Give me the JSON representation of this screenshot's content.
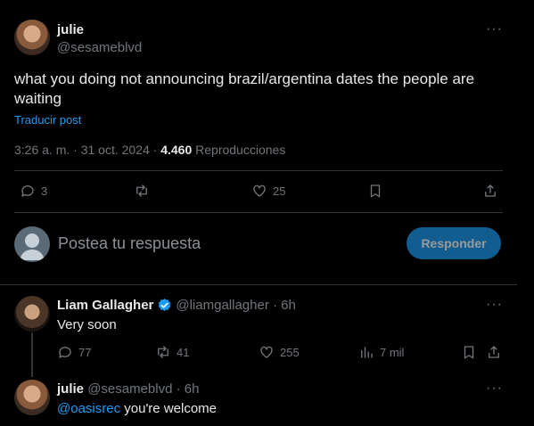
{
  "main_post": {
    "author": "julie",
    "handle": "@sesameblvd",
    "text": "what you doing not announcing brazil/argentina dates the people are waiting",
    "translate": "Traducir post",
    "time": "3:26 a. m. · 31 oct. 2024 ·",
    "views": "4.460",
    "views_label": "Reproducciones",
    "replies": "3",
    "likes": "25",
    "more": "···"
  },
  "composer": {
    "placeholder": "Postea tu respuesta",
    "button": "Responder"
  },
  "reply1": {
    "author": "Liam Gallagher",
    "handle_time": "@liamgallagher · 6h",
    "text": "Very soon",
    "replies": "77",
    "reposts": "41",
    "likes": "255",
    "views": "7 mil",
    "more": "···"
  },
  "reply2": {
    "author": "julie",
    "handle_time": "@sesameblvd · 6h",
    "mention": "@oasisrec",
    "text": " you're welcome",
    "more": "···"
  },
  "colors": {
    "accent": "#1d9bf0",
    "verified": "#1d9bf0",
    "bg": "#000000",
    "muted": "#71767b"
  }
}
